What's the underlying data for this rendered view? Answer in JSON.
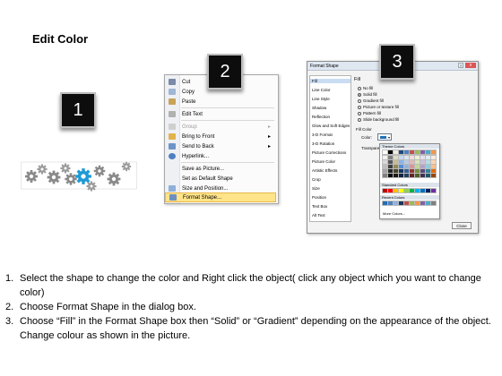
{
  "title": "Edit Color",
  "steps": [
    "1",
    "2",
    "3"
  ],
  "colors": {
    "accent_gear": "#1e9ad6",
    "gear_gray": "#8a8a8a",
    "step_box": "#0d0d0d",
    "menu_highlight": "#ffe48a"
  },
  "context_menu": {
    "items": [
      {
        "label": "Cut",
        "icon": "scissors-icon",
        "enabled": true,
        "submenu": false
      },
      {
        "label": "Copy",
        "icon": "copy-icon",
        "enabled": true,
        "submenu": false
      },
      {
        "label": "Paste",
        "icon": "paste-icon",
        "enabled": true,
        "submenu": false
      },
      {
        "label": "Edit Text",
        "icon": "edit-text-icon",
        "enabled": true,
        "submenu": false
      },
      {
        "label": "Group",
        "icon": "group-icon",
        "enabled": false,
        "submenu": true
      },
      {
        "label": "Bring to Front",
        "icon": "bring-to-front-icon",
        "enabled": true,
        "submenu": true
      },
      {
        "label": "Send to Back",
        "icon": "send-to-back-icon",
        "enabled": true,
        "submenu": true
      },
      {
        "label": "Hyperlink...",
        "icon": "hyperlink-icon",
        "enabled": true,
        "submenu": false
      },
      {
        "label": "Save as Picture...",
        "icon": "",
        "enabled": true,
        "submenu": false
      },
      {
        "label": "Set as Default Shape",
        "icon": "",
        "enabled": true,
        "submenu": false
      },
      {
        "label": "Size and Position...",
        "icon": "size-position-icon",
        "enabled": true,
        "submenu": false
      },
      {
        "label": "Format Shape...",
        "icon": "format-shape-icon",
        "enabled": true,
        "submenu": false,
        "highlighted": true
      }
    ]
  },
  "format_dialog": {
    "title": "Format Shape",
    "close_label": "x",
    "help_label": "?",
    "categories": [
      "Fill",
      "Line Color",
      "Line Style",
      "Shadow",
      "Reflection",
      "Glow and Soft Edges",
      "3-D Format",
      "3-D Rotation",
      "Picture Corrections",
      "Picture Color",
      "Artistic Effects",
      "Crop",
      "Size",
      "Position",
      "Text Box",
      "Alt Text"
    ],
    "selected_category": "Fill",
    "pane_title": "Fill",
    "fill_options": [
      {
        "label": "No fill",
        "selected": false
      },
      {
        "label": "Solid fill",
        "selected": true
      },
      {
        "label": "Gradient fill",
        "selected": false
      },
      {
        "label": "Picture or texture fill",
        "selected": false
      },
      {
        "label": "Pattern fill",
        "selected": false
      },
      {
        "label": "Slide background fill",
        "selected": false
      }
    ],
    "fill_color_heading": "Fill Color",
    "color_label": "Color:",
    "transparency_label": "Transpare",
    "palette": {
      "theme_heading": "Theme Colors",
      "theme_top_row": [
        "#ffffff",
        "#000000",
        "#eeece1",
        "#1f497d",
        "#4f81bd",
        "#c0504d",
        "#9bbb59",
        "#8064a2",
        "#4bacc6",
        "#f79646"
      ],
      "theme_shades": [
        [
          "#f2f2f2",
          "#7f7f7f",
          "#ddd9c3",
          "#c6d9f0",
          "#dbe5f1",
          "#f2dcdb",
          "#ebf1dd",
          "#e5e0ec",
          "#dbeef3",
          "#fdeada"
        ],
        [
          "#d8d8d8",
          "#595959",
          "#c4bd97",
          "#8db3e2",
          "#b8cce4",
          "#e5b9b7",
          "#d7e3bc",
          "#ccc1d9",
          "#b7dde8",
          "#fbd5b5"
        ],
        [
          "#bfbfbf",
          "#3f3f3f",
          "#938953",
          "#548dd4",
          "#95b3d7",
          "#d99694",
          "#c3d69b",
          "#b2a2c7",
          "#92cddc",
          "#fac08f"
        ],
        [
          "#a5a5a5",
          "#262626",
          "#494429",
          "#17365d",
          "#366092",
          "#953734",
          "#76923c",
          "#5f497a",
          "#31859b",
          "#e36c09"
        ],
        [
          "#7f7f7f",
          "#0c0c0c",
          "#1d1b10",
          "#0f243e",
          "#244061",
          "#632423",
          "#4f6128",
          "#3f3151",
          "#205867",
          "#974806"
        ]
      ],
      "standard_heading": "Standard Colors",
      "standard_colors": [
        "#c00000",
        "#ff0000",
        "#ffc000",
        "#ffff00",
        "#92d050",
        "#00b050",
        "#00b0f0",
        "#0070c0",
        "#002060",
        "#7030a0"
      ],
      "recent_heading": "Recent Colors",
      "recent_colors": [
        "#1f6fb5",
        "#4f81bd",
        "#8db3e2",
        "#17365d",
        "#c0504d",
        "#9bbb59",
        "#f79646",
        "#8064a2",
        "#4bacc6",
        "#7f7f7f"
      ],
      "more_label": "More Colors..."
    },
    "close_button": "Close"
  },
  "instructions": [
    {
      "num": "1.",
      "text": "Select the shape to change the color and Right click the object( click any object which you want to change color)"
    },
    {
      "num": "2.",
      "text": "Choose Format Shape in the dialog box."
    },
    {
      "num": "3.",
      "text": "Choose “Fill” in the Format Shape box then “Solid” or “Gradient” depending on the appearance of the object. Change colour as shown in the picture."
    }
  ]
}
